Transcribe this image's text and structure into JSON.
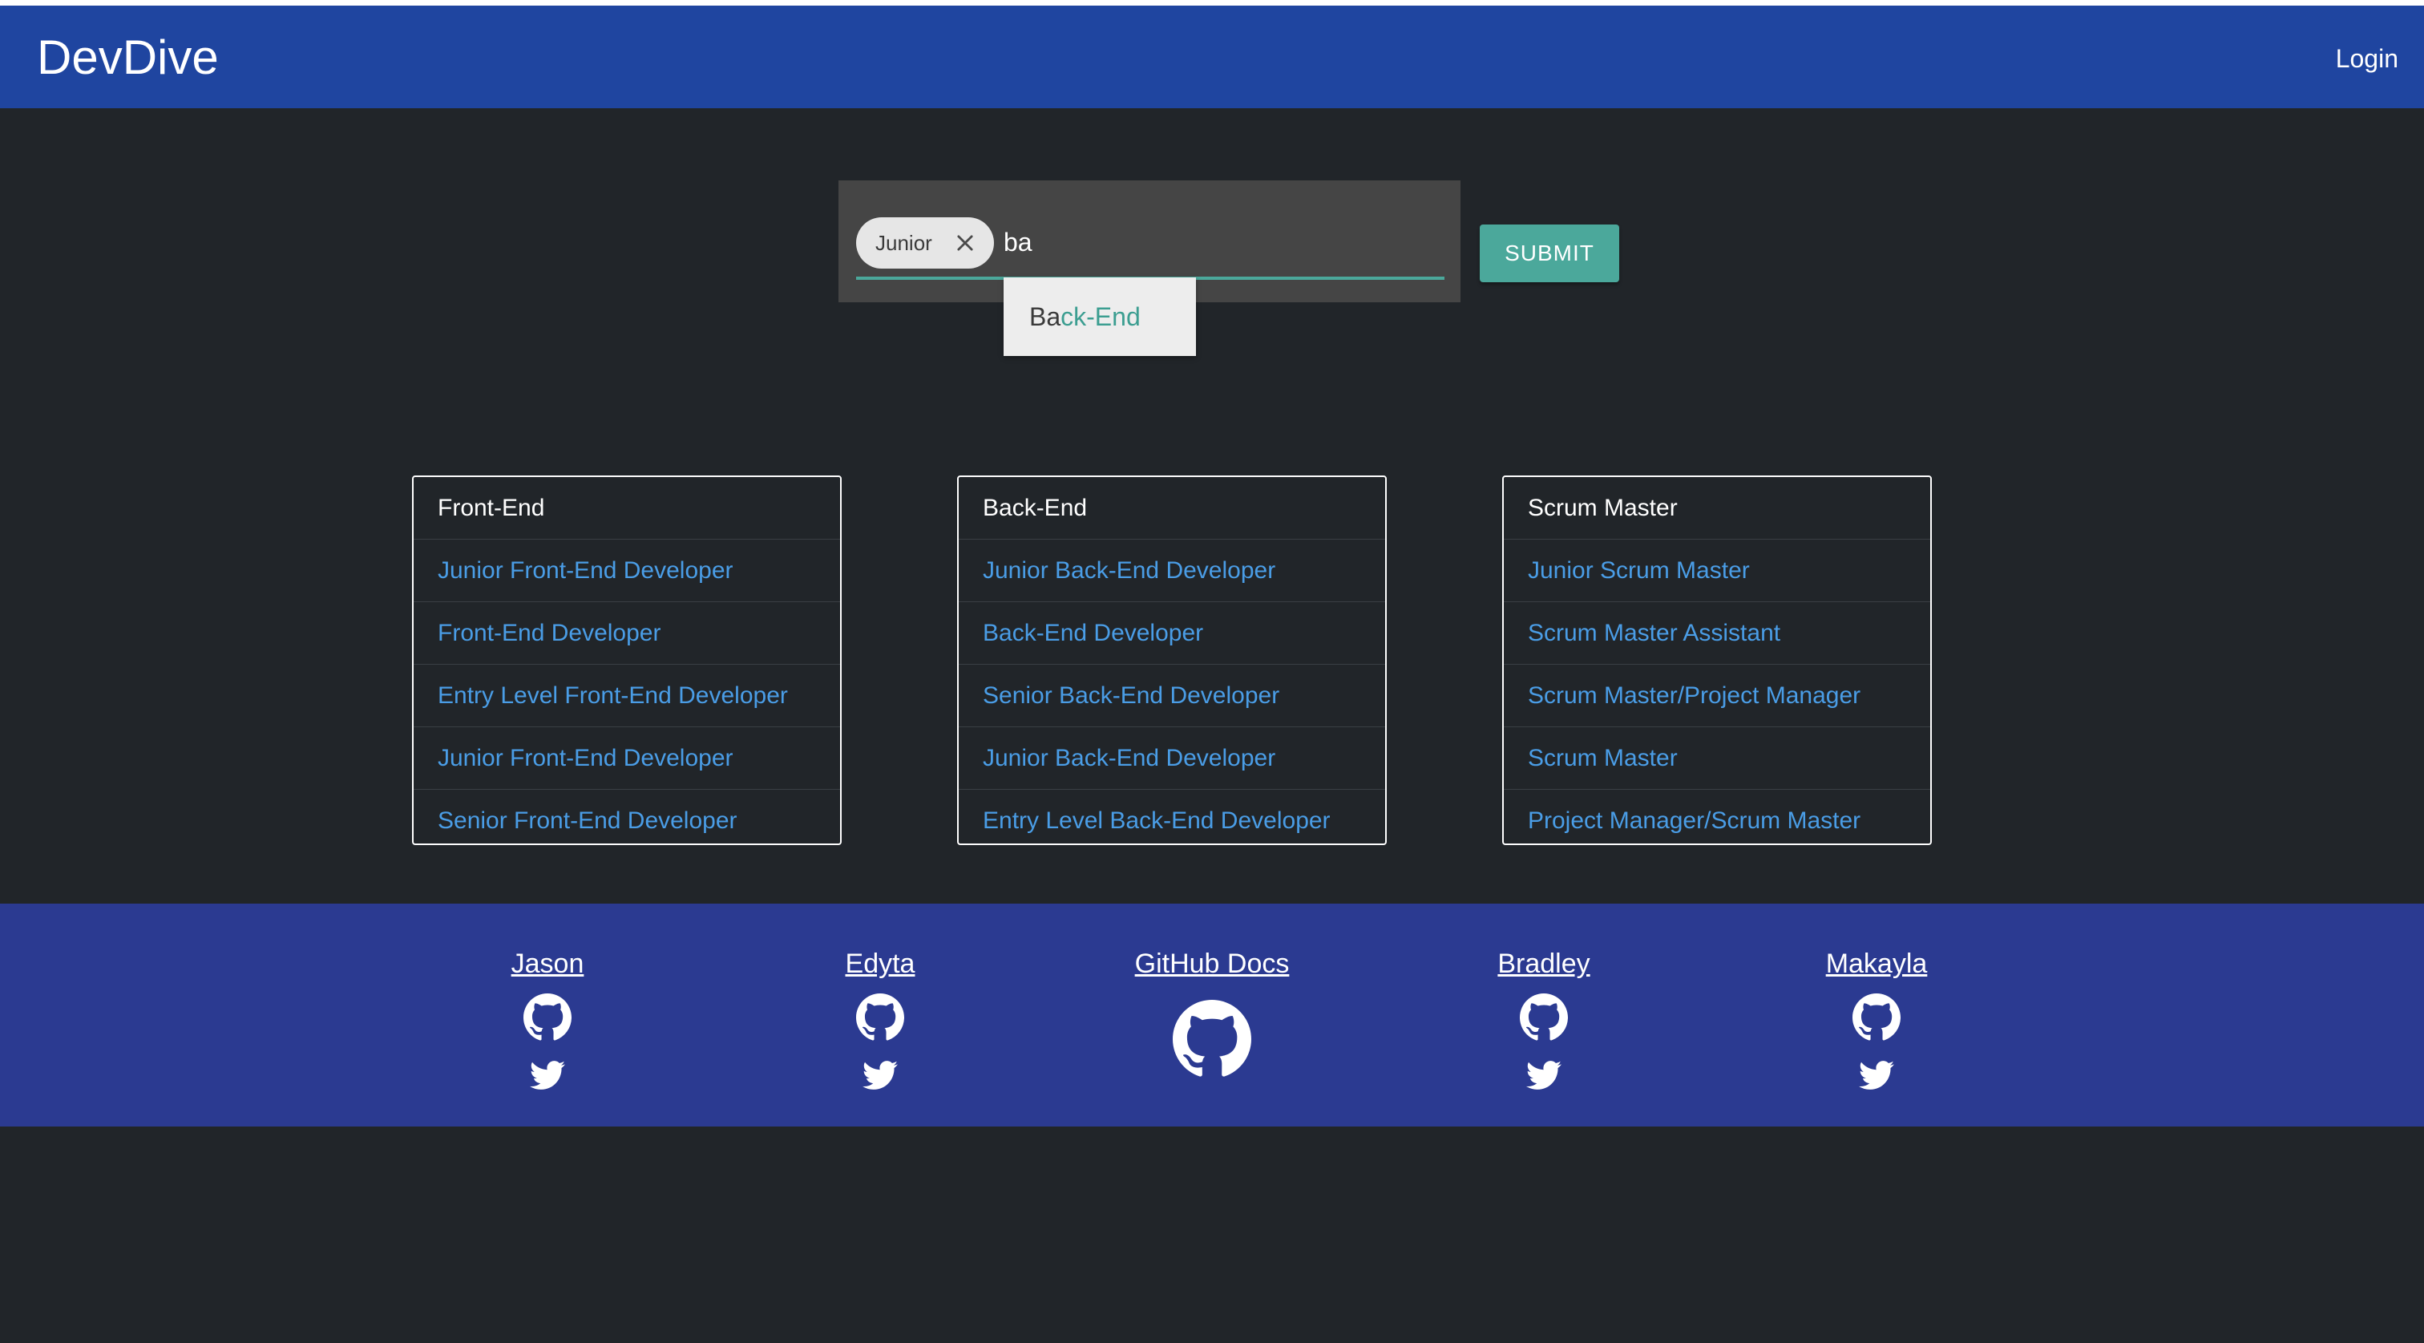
{
  "navbar": {
    "brand": "DevDive",
    "login_label": "Login"
  },
  "search": {
    "chips": [
      {
        "label": "Junior"
      }
    ],
    "input_value": "ba",
    "submit_label": "SUBMIT",
    "suggestion": {
      "match": "Ba",
      "rest": "ck-End"
    }
  },
  "cards": [
    {
      "title": "Front-End",
      "items": [
        "Junior Front-End Developer",
        "Front-End Developer",
        "Entry Level Front-End Developer",
        "Junior Front-End Developer",
        "Senior Front-End Developer"
      ]
    },
    {
      "title": "Back-End",
      "items": [
        "Junior Back-End Developer",
        "Back-End Developer",
        "Senior Back-End Developer",
        "Junior Back-End Developer",
        "Entry Level Back-End Developer"
      ]
    },
    {
      "title": "Scrum Master",
      "items": [
        "Junior Scrum Master",
        "Scrum Master Assistant",
        "Scrum Master/Project Manager",
        "Scrum Master",
        "Project Manager/Scrum Master"
      ]
    }
  ],
  "footer": {
    "people": [
      {
        "name": "Jason",
        "icons": [
          "github-icon",
          "twitter-icon"
        ]
      },
      {
        "name": "Edyta",
        "icons": [
          "github-icon",
          "twitter-icon"
        ]
      },
      {
        "name": "GitHub Docs",
        "icons": [
          "github-icon"
        ]
      },
      {
        "name": "Bradley",
        "icons": [
          "github-icon",
          "twitter-icon"
        ]
      },
      {
        "name": "Makayla",
        "icons": [
          "github-icon",
          "twitter-icon"
        ]
      }
    ]
  },
  "colors": {
    "navbar": "#1f45a0",
    "background": "#212529",
    "accent": "#4ba89b",
    "link": "#4a9de6",
    "footer": "#2b3a91"
  }
}
